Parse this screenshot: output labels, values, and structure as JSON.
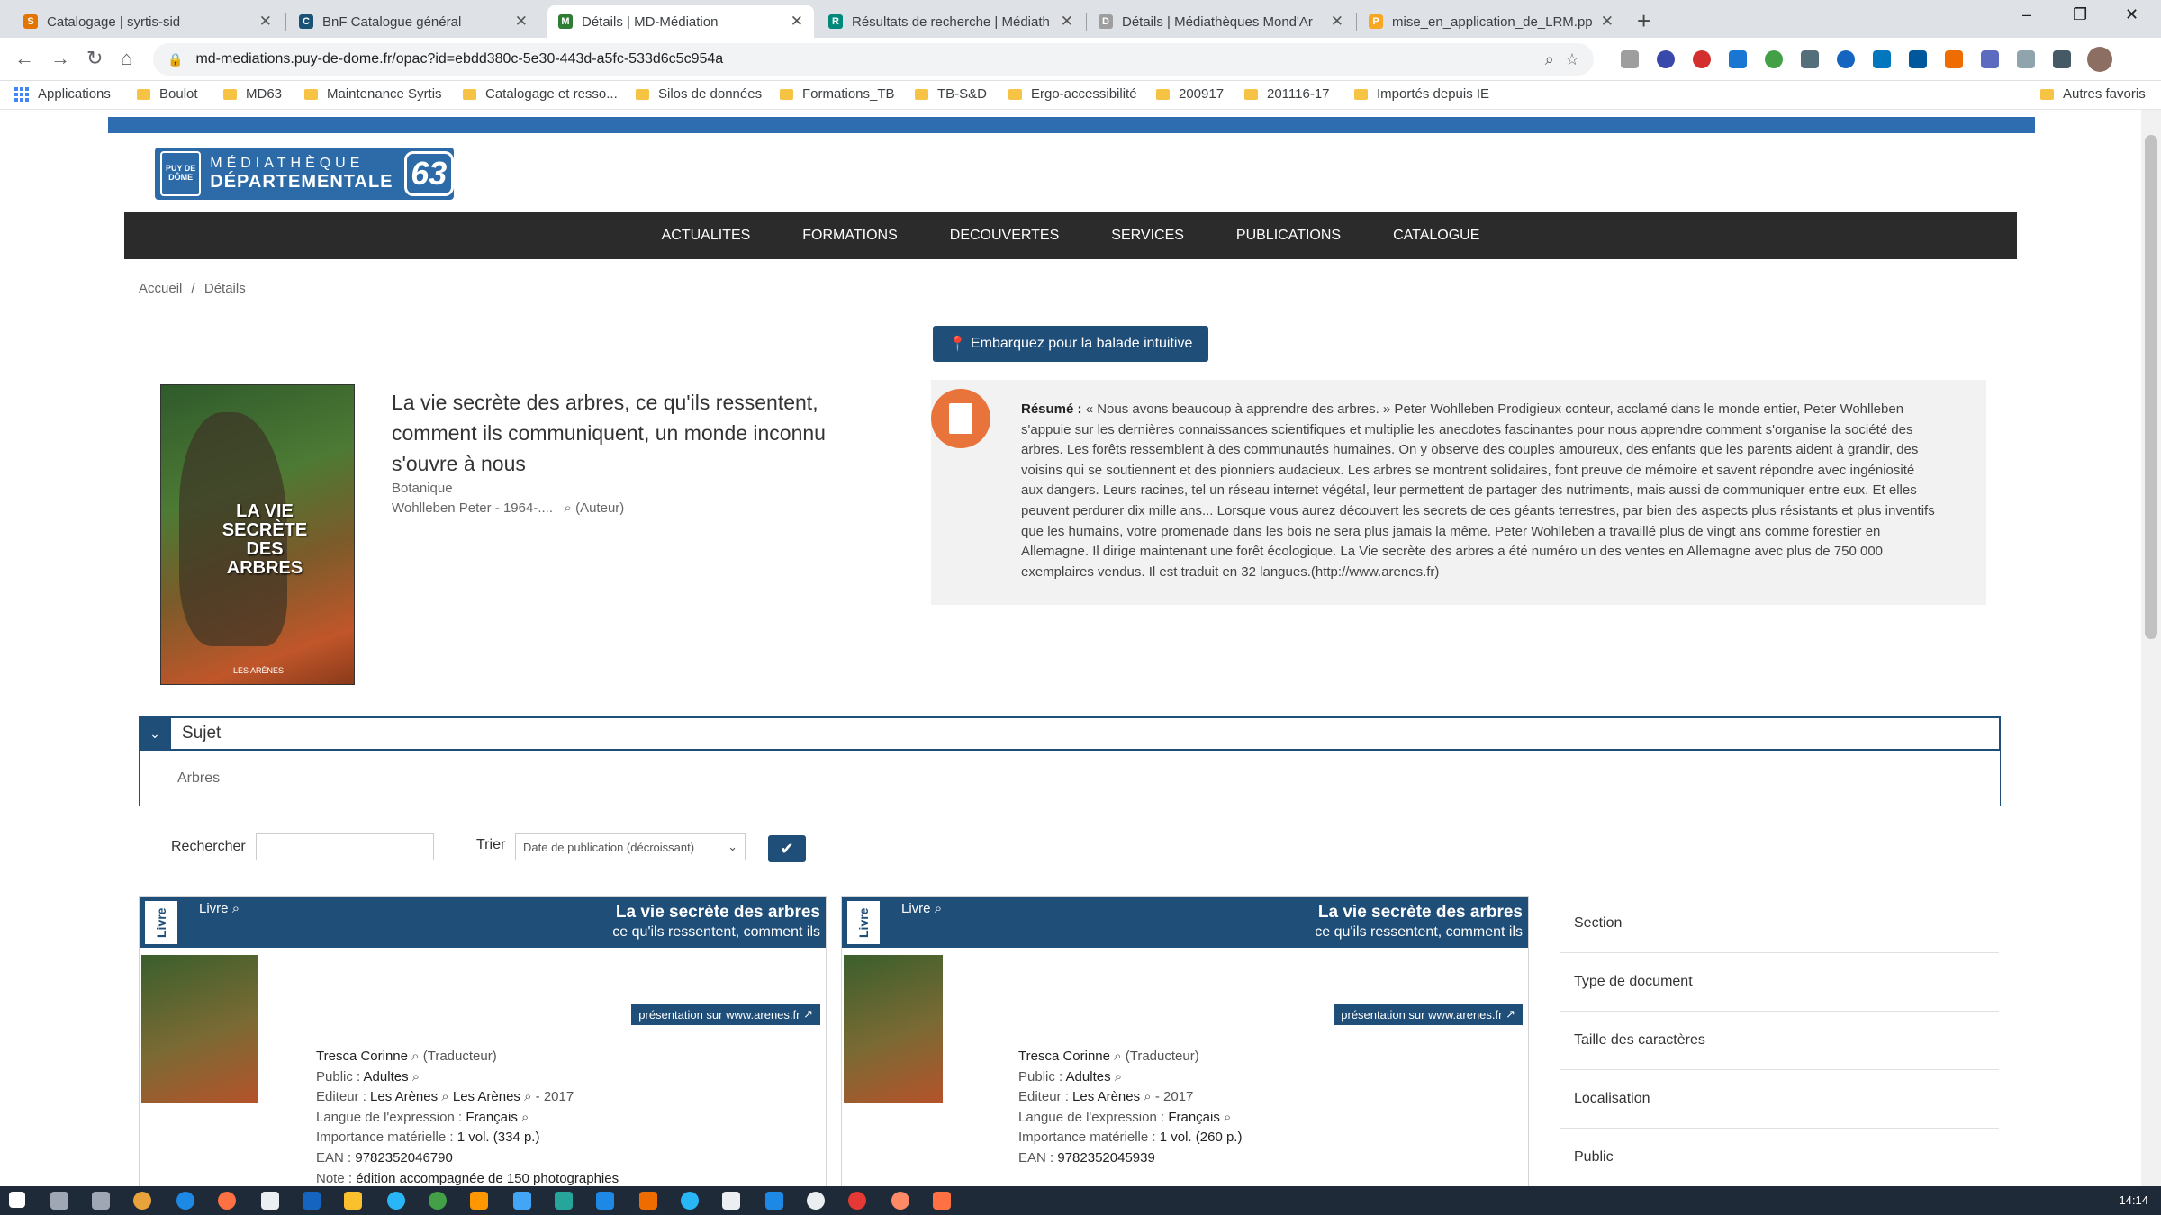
{
  "browser": {
    "tabs": [
      {
        "title": "Catalogage | syrtis-sid",
        "color": "#e37400",
        "glyph": "S"
      },
      {
        "title": "BnF Catalogue général",
        "color": "#1a5276",
        "glyph": "C"
      },
      {
        "title": "Détails | MD-Médiation",
        "color": "#2e7d32",
        "glyph": "M",
        "active": true
      },
      {
        "title": "Résultats de recherche | Médiath",
        "color": "#00897b",
        "glyph": "R"
      },
      {
        "title": "Détails | Médiathèques Mond'Ar",
        "color": "#9e9e9e",
        "glyph": "D"
      },
      {
        "title": "mise_en_application_de_LRM.pp",
        "color": "#f9a825",
        "glyph": "P"
      }
    ],
    "new_tab": "+",
    "window_controls": {
      "minimize": "–",
      "restore": "❐",
      "close": "✕"
    },
    "nav": {
      "back": "←",
      "forward": "→",
      "reload": "↻",
      "home": "⌂"
    },
    "url": "md-mediations.puy-de-dome.fr/opac?id=ebdd380c-5e30-443d-a5fc-533d6c5c954a",
    "bookmarks": [
      {
        "label": "Applications",
        "kind": "apps"
      },
      {
        "label": "Boulot",
        "kind": "folder"
      },
      {
        "label": "MD63",
        "kind": "folder"
      },
      {
        "label": "Maintenance Syrtis",
        "kind": "folder"
      },
      {
        "label": "Catalogage et resso...",
        "kind": "folder"
      },
      {
        "label": "Silos de données",
        "kind": "folder"
      },
      {
        "label": "Formations_TB",
        "kind": "folder"
      },
      {
        "label": "TB-S&D",
        "kind": "folder"
      },
      {
        "label": "Ergo-accessibilité",
        "kind": "folder"
      },
      {
        "label": "200917",
        "kind": "folder"
      },
      {
        "label": "201116-17",
        "kind": "folder"
      },
      {
        "label": "Importés depuis IE",
        "kind": "folder"
      }
    ],
    "other_bookmarks": "Autres favoris"
  },
  "site": {
    "logo": {
      "seal": "PUY DE DÔME",
      "line1": "MÉDIATHÈQUE",
      "line2": "DÉPARTEMENTALE",
      "number": "63"
    },
    "menu": [
      "ACTUALITES",
      "FORMATIONS",
      "DECOUVERTES",
      "SERVICES",
      "PUBLICATIONS",
      "CATALOGUE"
    ],
    "breadcrumb": {
      "home": "Accueil",
      "sep": "/",
      "current": "Détails"
    }
  },
  "record": {
    "cover": {
      "title": "LA VIE SECRÈTE DES ARBRES",
      "publisher": "LES ARÈNES"
    },
    "title": "La vie secrète des arbres, ce qu'ils ressentent, comment ils communiquent, un monde inconnu s'ouvre à nous",
    "genre": "Botanique",
    "author": "Wohlleben Peter - 1964-....",
    "author_role": "(Auteur)",
    "balade_button": "Embarquez pour la balade intuitive",
    "resume_label": "Résumé :",
    "resume_text": "« Nous avons beaucoup à apprendre des arbres. » Peter Wohlleben Prodigieux conteur, acclamé dans le monde entier, Peter Wohlleben s'appuie sur les dernières connaissances scientifiques et multiplie les anecdotes fascinantes pour nous apprendre comment s'organise la société des arbres. Les forêts ressemblent à des communautés humaines. On y observe des couples amoureux, des enfants que les parents aident à grandir, des voisins qui se soutiennent et des pionniers audacieux. Les arbres se montrent solidaires, font preuve de mémoire et savent répondre avec ingéniosité aux dangers. Leurs racines, tel un réseau internet végétal, leur permettent de partager des nutriments, mais aussi de communiquer entre eux. Et elles peuvent perdurer dix mille ans... Lorsque vous aurez découvert les secrets de ces géants terrestres, par bien des aspects plus résistants et plus inventifs que les humains, votre promenade dans les bois ne sera plus jamais la même. Peter Wohlleben a travaillé plus de vingt ans comme forestier en Allemagne. Il dirige maintenant une forêt écologique. La Vie secrète des arbres a été numéro un des ventes en Allemagne avec plus de 750 000 exemplaires vendus. Il est traduit en 32 langues.(http://www.arenes.fr)"
  },
  "subject": {
    "heading": "Sujet",
    "toggle": "⌄",
    "value": "Arbres"
  },
  "filters": {
    "search_label": "Rechercher",
    "search_value": "",
    "sort_label": "Trier",
    "sort_value": "Date de publication (décroissant)",
    "submit": "✔"
  },
  "results": [
    {
      "badge": "Livre",
      "type": "Livre",
      "title": "La vie secrète des arbres",
      "subtitle": "ce qu'ils ressentent, comment ils",
      "presentation": "présentation sur www.arenes.fr",
      "translator": "Tresca Corinne",
      "translator_role": "(Traducteur)",
      "public_label": "Public :",
      "public": "Adultes",
      "editor_label": "Editeur :",
      "editor": "Les Arènes",
      "editor2": "Les Arènes",
      "year": "- 2017",
      "lang_label": "Langue de l'expression :",
      "lang": "Français",
      "size_label": "Importance matérielle :",
      "size": "1 vol. (334 p.)",
      "ean_label": "EAN :",
      "ean": "9782352046790",
      "note_label": "Note :",
      "note": "édition accompagnée de 150 photographies"
    },
    {
      "badge": "Livre",
      "type": "Livre",
      "title": "La vie secrète des arbres",
      "subtitle": "ce qu'ils ressentent, comment ils",
      "presentation": "présentation sur www.arenes.fr",
      "translator": "Tresca Corinne",
      "translator_role": "(Traducteur)",
      "public_label": "Public :",
      "public": "Adultes",
      "editor_label": "Editeur :",
      "editor": "Les Arènes",
      "year": "- 2017",
      "lang_label": "Langue de l'expression :",
      "lang": "Français",
      "size_label": "Importance matérielle :",
      "size": "1 vol. (260 p.)",
      "ean_label": "EAN :",
      "ean": "9782352045939"
    }
  ],
  "facets": [
    "Section",
    "Type de document",
    "Taille des caractères",
    "Localisation",
    "Public"
  ],
  "taskbar": {
    "clock": "14:14"
  }
}
